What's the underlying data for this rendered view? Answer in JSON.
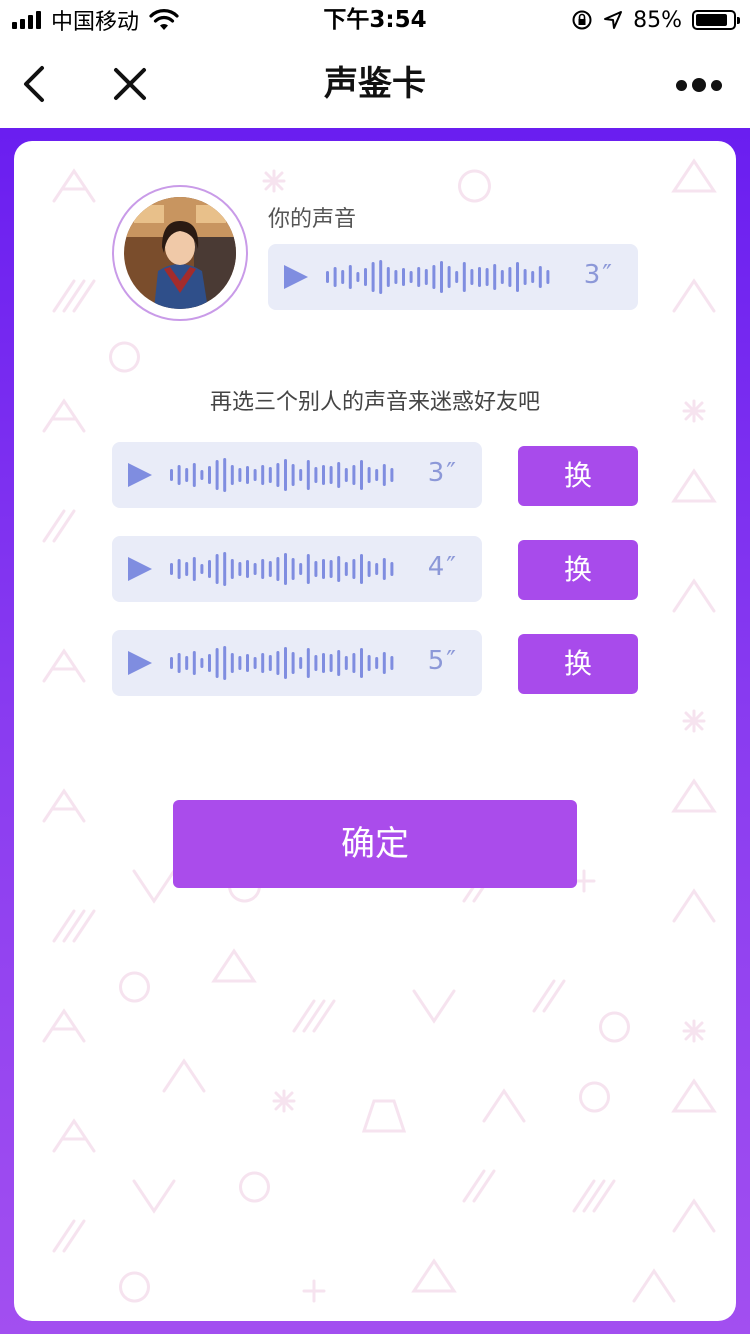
{
  "status_bar": {
    "carrier": "中国移动",
    "time": "下午3:54",
    "battery": "85%",
    "battery_level": 0.85
  },
  "nav": {
    "title": "声鉴卡",
    "back_icon": "chevron-left-icon",
    "close_icon": "close-icon",
    "more_icon": "more-dots-icon"
  },
  "my_voice": {
    "label": "你的声音",
    "duration": "3″"
  },
  "instruction": "再选三个别人的声音来迷惑好友吧",
  "voices": [
    {
      "duration": "3″",
      "swap_label": "换"
    },
    {
      "duration": "4″",
      "swap_label": "换"
    },
    {
      "duration": "5″",
      "swap_label": "换"
    }
  ],
  "confirm_label": "确定",
  "colors": {
    "accent": "#aa4ceb",
    "background_top": "#6a1ef0",
    "background_bottom": "#a24ff0",
    "bubble": "#e9ecf8",
    "wave": "#7f8de0"
  }
}
